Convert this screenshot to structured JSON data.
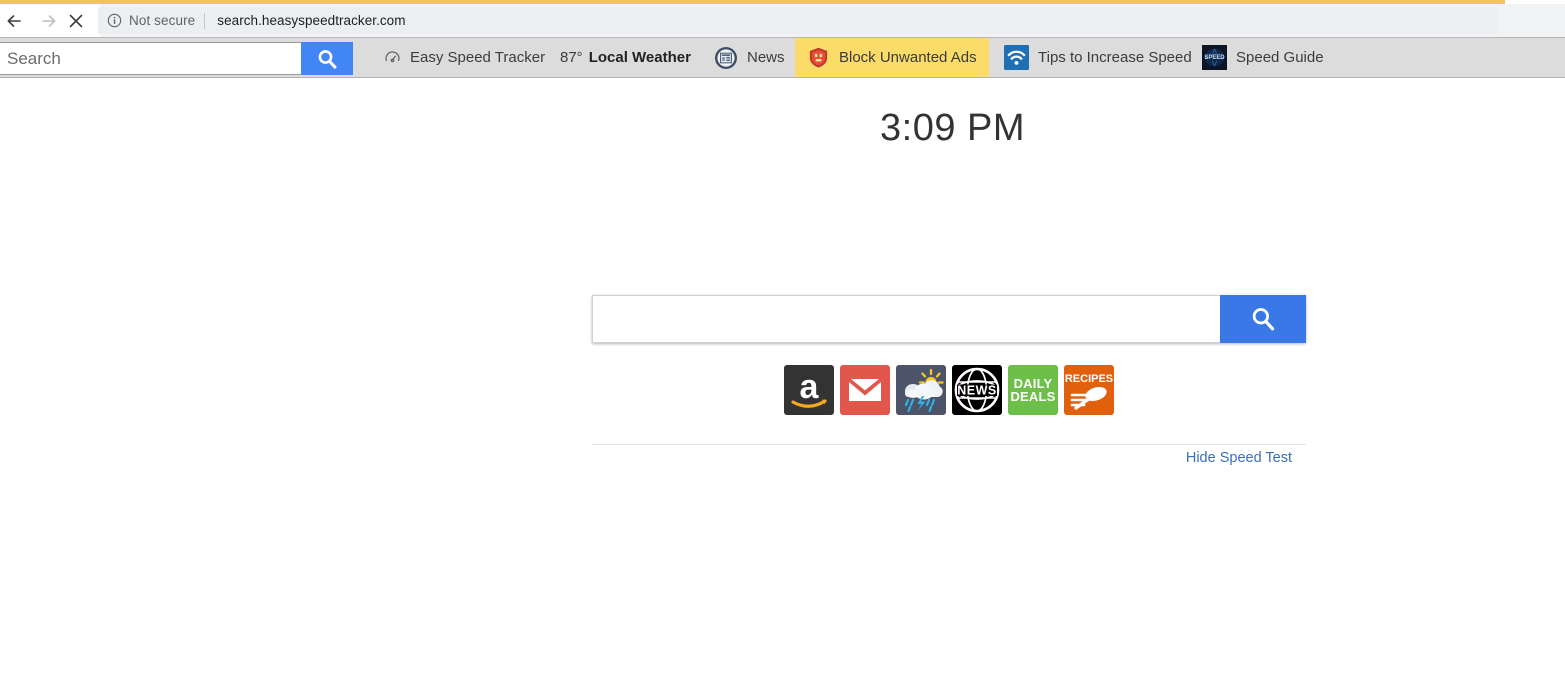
{
  "browser": {
    "back_icon": "arrow-left-icon",
    "forward_icon": "arrow-right-icon",
    "stop_icon": "close-x-icon",
    "info_icon": "info-circle-icon",
    "security_label": "Not secure",
    "url": "search.heasyspeedtracker.com"
  },
  "ext_toolbar": {
    "search_placeholder": "Search",
    "search_value": "",
    "search_button_icon": "search-icon",
    "items": [
      {
        "id": "speed-tracker",
        "icon": "speedometer-icon",
        "label": "Easy Speed Tracker",
        "bold": false,
        "temp": ""
      },
      {
        "id": "local-weather",
        "icon": "",
        "label": "Local Weather",
        "bold": true,
        "temp": "87°"
      },
      {
        "id": "news",
        "icon": "newspaper-icon",
        "label": "News",
        "bold": false,
        "temp": ""
      },
      {
        "id": "block-ads",
        "icon": "shield-icon",
        "label": "Block Unwanted Ads",
        "bold": false,
        "temp": ""
      },
      {
        "id": "tips-speed",
        "icon": "wifi-icon",
        "label": "Tips to Increase Speed",
        "bold": false,
        "temp": ""
      },
      {
        "id": "speed-guide",
        "icon": "speed-globe-icon",
        "label": "Speed Guide",
        "bold": false,
        "temp": ""
      }
    ],
    "highlight_color": "#fbdc69",
    "background_color": "#dcdcdc"
  },
  "page": {
    "clock": "3:09 PM",
    "search_value": "",
    "search_placeholder": "",
    "search_button_icon": "search-icon",
    "accent_color": "#3b78e7",
    "hide_speed_test_label": "Hide Speed Test",
    "hide_speed_test_color": "#3b6fbb",
    "shortcuts": [
      {
        "id": "amazon",
        "name": "amazon-shortcut",
        "label": "a",
        "bg": "#333333"
      },
      {
        "id": "mail",
        "name": "gmail-shortcut",
        "label": "",
        "bg": "#e2574c"
      },
      {
        "id": "weather",
        "name": "weather-shortcut",
        "label": "",
        "bg": "#4b5468"
      },
      {
        "id": "news",
        "name": "news-shortcut",
        "label": "NEWS",
        "bg": "#000000"
      },
      {
        "id": "daily-deals",
        "name": "daily-deals-shortcut",
        "label": "DAILY DEALS",
        "bg": "#6cc04a"
      },
      {
        "id": "recipes",
        "name": "recipes-shortcut",
        "label": "RECIPES",
        "bg": "#e0600e"
      }
    ]
  }
}
